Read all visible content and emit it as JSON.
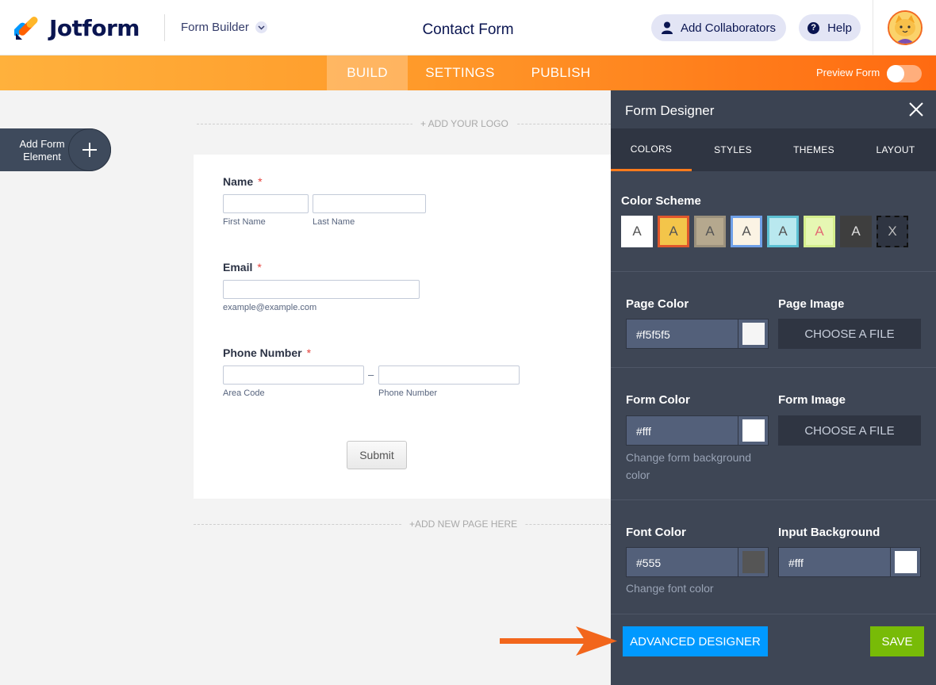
{
  "header": {
    "logo_text": "Jotform",
    "builder_select": "Form Builder",
    "form_title": "Contact Form",
    "collaborators_label": "Add Collaborators",
    "help_label": "Help"
  },
  "navbar": {
    "tabs": [
      {
        "label": "BUILD",
        "active": true
      },
      {
        "label": "SETTINGS",
        "active": false
      },
      {
        "label": "PUBLISH",
        "active": false
      }
    ],
    "preview_label": "Preview Form"
  },
  "canvas": {
    "add_logo": "+ ADD YOUR LOGO",
    "add_page": "+ADD NEW PAGE HERE",
    "add_element_line1": "Add Form",
    "add_element_line2": "Element"
  },
  "form": {
    "name_label": "Name",
    "first_name": "First Name",
    "last_name": "Last Name",
    "email_label": "Email",
    "email_hint": "example@example.com",
    "phone_label": "Phone Number",
    "area_code": "Area Code",
    "phone_number": "Phone Number",
    "phone_separator": "–",
    "required_mark": "*",
    "submit": "Submit"
  },
  "designer": {
    "title": "Form Designer",
    "tabs": [
      {
        "label": "COLORS",
        "active": true
      },
      {
        "label": "STYLES",
        "active": false
      },
      {
        "label": "THEMES",
        "active": false
      },
      {
        "label": "LAYOUT",
        "active": false
      }
    ],
    "color_scheme_label": "Color Scheme",
    "schemes": [
      {
        "letter": "A",
        "bg": "#ffffff",
        "border": "#ffffff",
        "fg": "#555555"
      },
      {
        "letter": "A",
        "bg": "#f3c54a",
        "border": "#e0572c",
        "fg": "#555555"
      },
      {
        "letter": "A",
        "bg": "#b5a88e",
        "border": "#9b917d",
        "fg": "#555555"
      },
      {
        "letter": "A",
        "bg": "#fbf3e4",
        "border": "#6fa0e8",
        "fg": "#555555"
      },
      {
        "letter": "A",
        "bg": "#b9e8ef",
        "border": "#5dc0d3",
        "fg": "#555555"
      },
      {
        "letter": "A",
        "bg": "#e6f7b3",
        "border": "#d4ee8e",
        "fg": "#e46a74"
      },
      {
        "letter": "A",
        "bg": "#3e3e3e",
        "border": "#3e3e3e",
        "fg": "#dddddd"
      },
      {
        "letter": "X",
        "bg": "#2f3542",
        "border": "#111111",
        "fg": "#bbbbbb"
      }
    ],
    "page_color_label": "Page Color",
    "page_color_value": "#f5f5f5",
    "page_image_label": "Page Image",
    "form_color_label": "Form Color",
    "form_color_value": "#fff",
    "form_color_hint": "Change form background color",
    "form_image_label": "Form Image",
    "choose_file": "CHOOSE A FILE",
    "font_color_label": "Font Color",
    "font_color_value": "#555",
    "font_color_hint": "Change font color",
    "input_bg_label": "Input Background",
    "input_bg_value": "#fff",
    "advanced_designer": "ADVANCED DESIGNER",
    "save": "SAVE"
  },
  "colors": {
    "brand_navy": "#0a1551",
    "accent_orange": "#ff7b1c",
    "advanced_blue": "#0099ff",
    "save_green": "#78bb07",
    "arrow": "#f2661c"
  }
}
